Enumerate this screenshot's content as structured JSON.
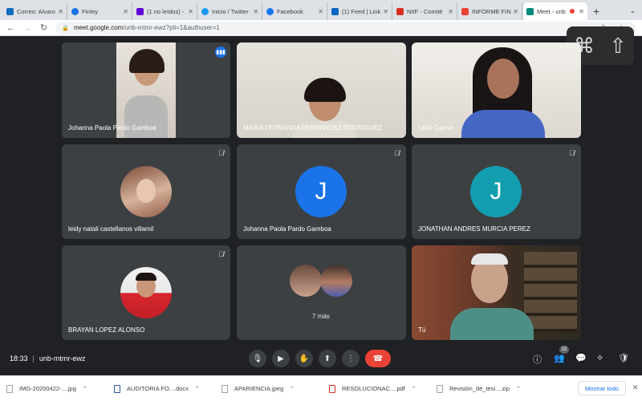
{
  "browser": {
    "tabs": [
      {
        "label": "Correo: Alvaro",
        "color": "#0f6cbd"
      },
      {
        "label": "Finley",
        "color": "#1a73e8"
      },
      {
        "label": "(1 no leídos) -",
        "color": "#6001d2"
      },
      {
        "label": "Inicio / Twitter",
        "color": "#1d9bf0"
      },
      {
        "label": "Facebook",
        "color": "#1877f2"
      },
      {
        "label": "(1) Feed | Link",
        "color": "#0a66c2"
      },
      {
        "label": "NIIF - Comité",
        "color": "#d93025"
      },
      {
        "label": "INFORME FINA",
        "color": "#ea4335"
      },
      {
        "label": "Meet - unb",
        "color": "#00897b",
        "active": true
      }
    ],
    "new_tab": "+",
    "url_host": "meet.google.com",
    "url_path": "/unb-mtmr-ewz?pli=1&authuser=1"
  },
  "overlay": {
    "cmd_symbol": "⌘",
    "shift_symbol": "⇧"
  },
  "participants": [
    {
      "name": "Johanna Paola Pardo Gamboa",
      "type": "video",
      "speaking": true
    },
    {
      "name": "MARIA FERNANDA HERNANDEZ RODRIGUEZ",
      "type": "video"
    },
    {
      "name": "Leidi Cuervo",
      "type": "video"
    },
    {
      "name": "leidy natali castellanos villamil",
      "type": "photo"
    },
    {
      "name": "Johanna Paola Pardo Gamboa",
      "type": "letter",
      "letter": "J",
      "color": "#1a73e8"
    },
    {
      "name": "JONATHAN ANDRES MURCIA PEREZ",
      "type": "letter",
      "letter": "J",
      "color": "#129eaf"
    },
    {
      "name": "BRAYAN LOPEZ ALONSO",
      "type": "photo"
    },
    {
      "name": "",
      "type": "more",
      "more_label": "7 más"
    },
    {
      "name": "Tú",
      "type": "video"
    }
  ],
  "meeting": {
    "time": "18:33",
    "separator": "|",
    "code": "unb-mtmr-ewz",
    "participant_count": "15"
  },
  "downloads": [
    {
      "name": "IMG-20200422-....jpg"
    },
    {
      "name": "AUDITORIA FO....docx"
    },
    {
      "name": "APARIENCIA.jpeg"
    },
    {
      "name": "RESOLUCIONAC....pdf"
    },
    {
      "name": "Revisión_de_tesi....zip"
    }
  ],
  "show_all_label": "Mostrar todo"
}
